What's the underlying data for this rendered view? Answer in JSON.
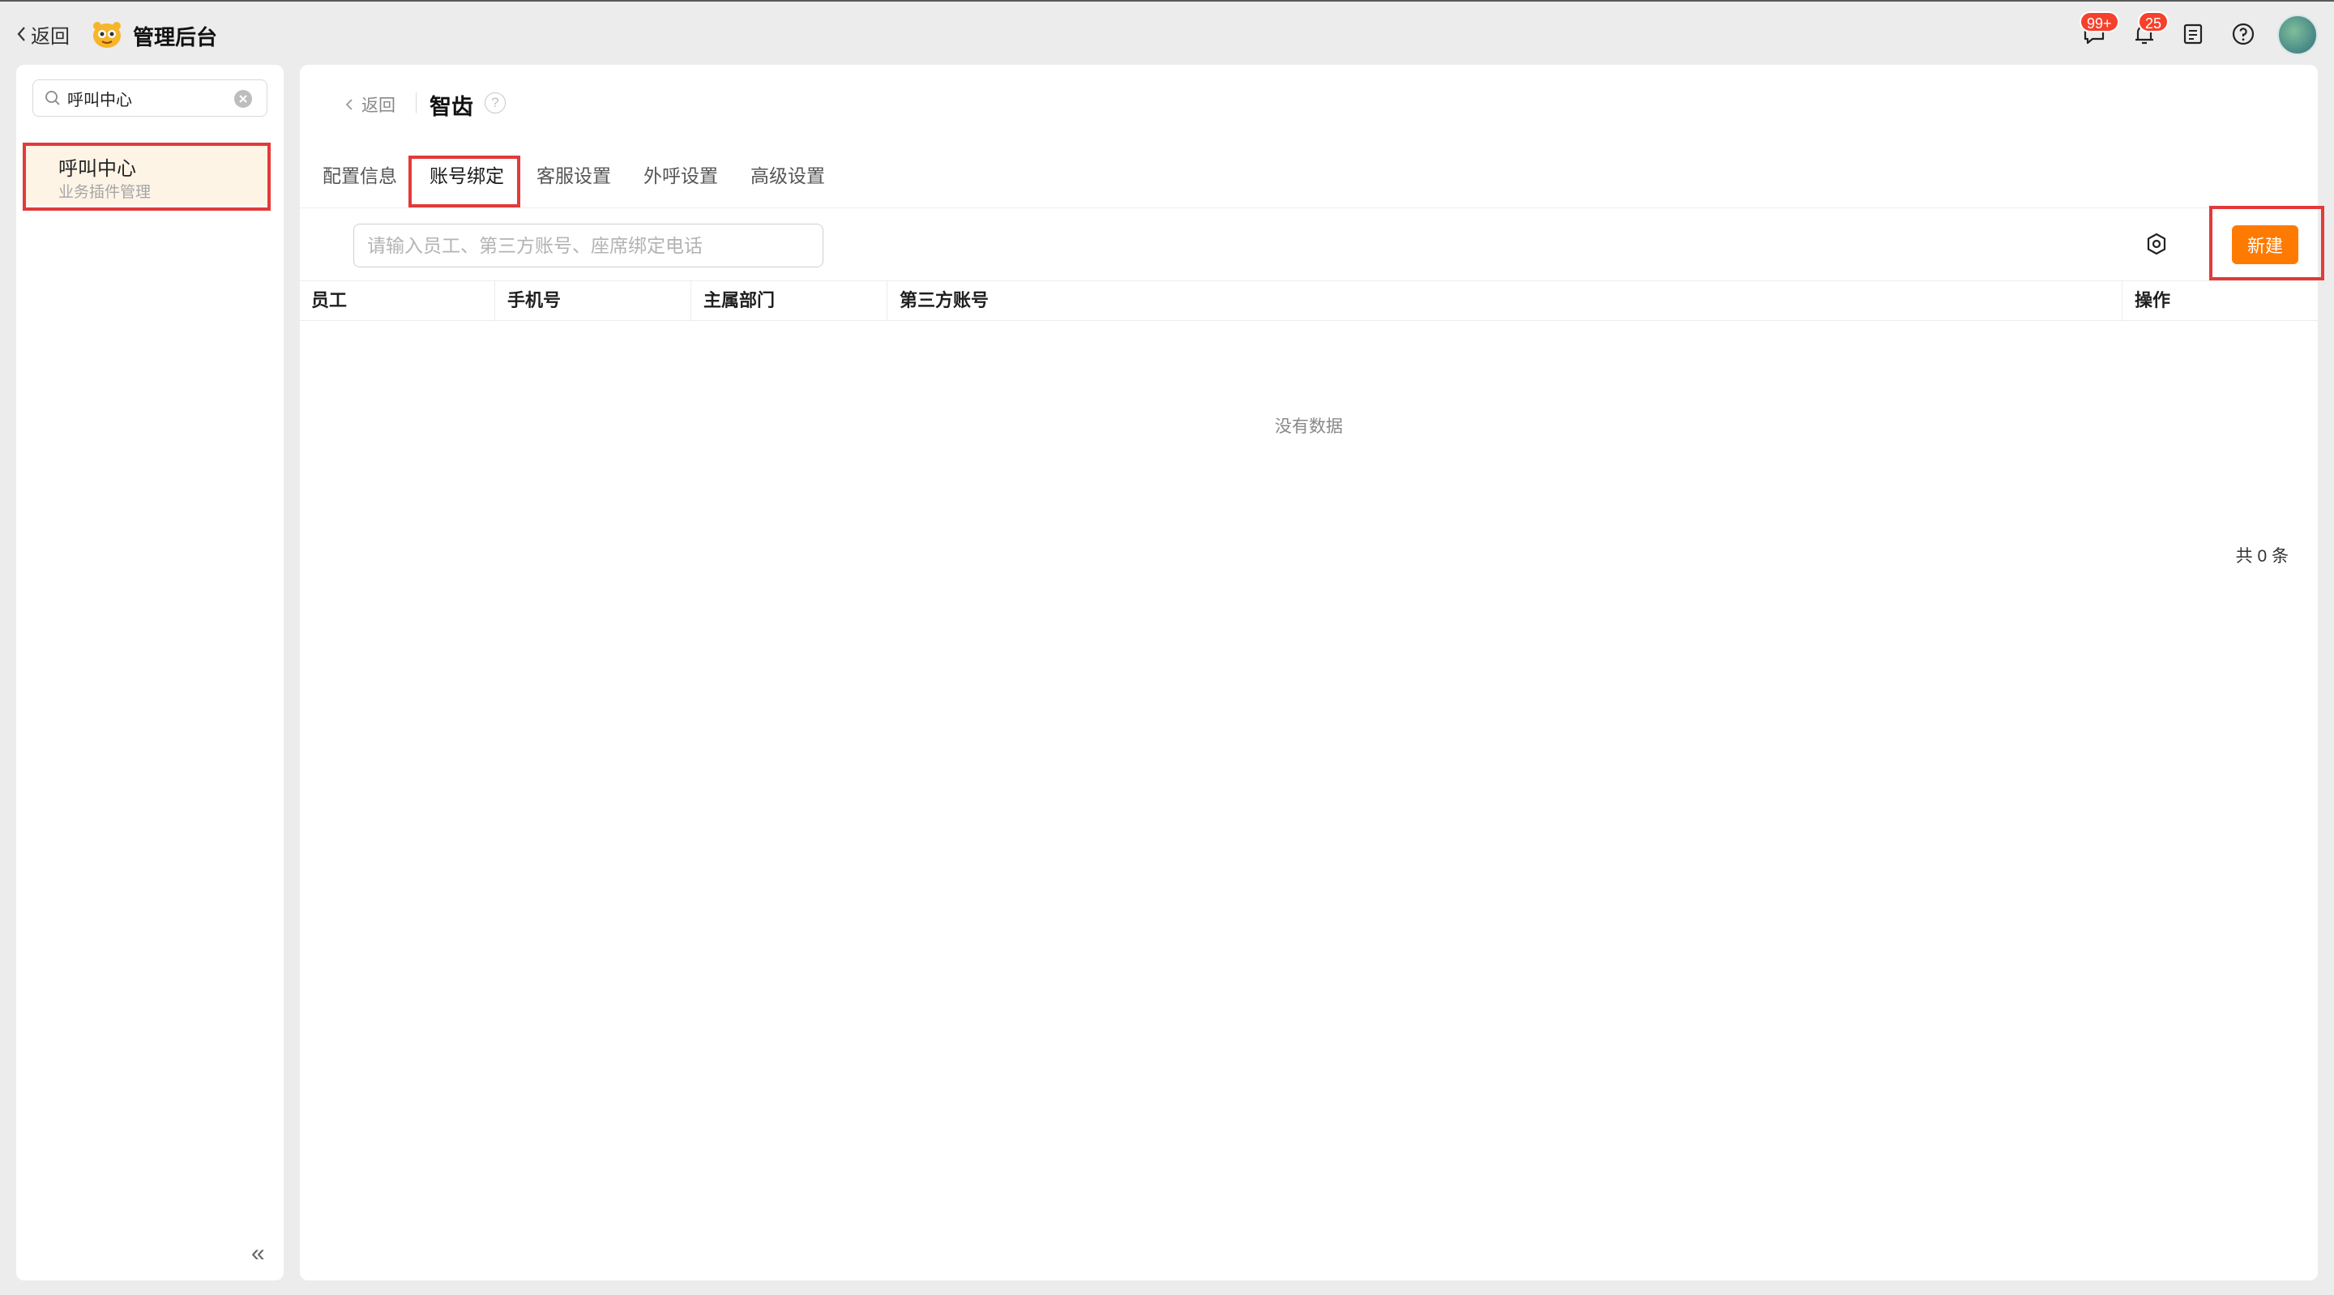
{
  "topbar": {
    "back_label": "返回",
    "app_title": "管理后台",
    "messages_badge": "99+",
    "notifications_badge": "25"
  },
  "sidebar": {
    "search_value": "呼叫中心",
    "item": {
      "title": "呼叫中心",
      "subtitle": "业务插件管理"
    },
    "collapse_glyph": "«"
  },
  "main": {
    "back_label": "返回",
    "title": "智齿",
    "tabs": [
      {
        "label": "配置信息",
        "active": false
      },
      {
        "label": "账号绑定",
        "active": true
      },
      {
        "label": "客服设置",
        "active": false
      },
      {
        "label": "外呼设置",
        "active": false
      },
      {
        "label": "高级设置",
        "active": false
      }
    ],
    "search_placeholder": "请输入员工、第三方账号、座席绑定电话",
    "new_button": "新建",
    "columns": [
      "员工",
      "手机号",
      "主属部门",
      "第三方账号",
      "操作"
    ],
    "empty_text": "没有数据",
    "total_text": "共 0 条"
  },
  "colors": {
    "accent": "#ff7a00",
    "badge": "#f5412c",
    "highlight_annotation": "#e23a3a",
    "selected_item_bg": "#fdf4e6"
  },
  "icons": [
    "chevron-left-icon",
    "app-logo",
    "message-icon",
    "bell-icon",
    "document-icon",
    "help-icon",
    "avatar",
    "search-icon",
    "clear-icon",
    "settings-icon",
    "collapse-icon"
  ]
}
